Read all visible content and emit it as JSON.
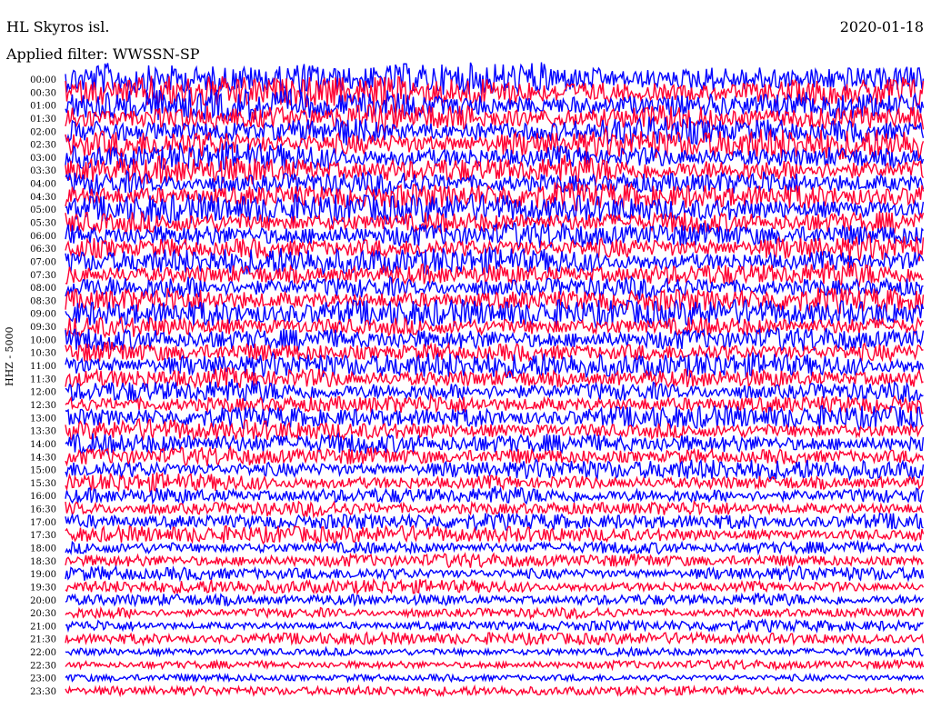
{
  "header": {
    "title": "HL Skyros isl.",
    "date": "2020-01-18",
    "filter": "Applied filter: WWSSN-SP"
  },
  "chart_data": {
    "type": "line",
    "title": "HL Skyros isl.",
    "ylabel": "HHZ - 5000",
    "categories": [
      "00:00",
      "00:30",
      "01:00",
      "01:30",
      "02:00",
      "02:30",
      "03:00",
      "03:30",
      "04:00",
      "04:30",
      "05:00",
      "05:30",
      "06:00",
      "06:30",
      "07:00",
      "07:30",
      "08:00",
      "08:30",
      "09:00",
      "09:30",
      "10:00",
      "10:30",
      "11:00",
      "11:30",
      "12:00",
      "12:30",
      "13:00",
      "13:30",
      "14:00",
      "14:30",
      "15:00",
      "15:30",
      "16:00",
      "16:30",
      "17:00",
      "17:30",
      "18:00",
      "18:30",
      "19:00",
      "19:30",
      "20:00",
      "20:30",
      "21:00",
      "21:30",
      "22:00",
      "22:30",
      "23:00",
      "23:30"
    ],
    "amplitude": [
      1.0,
      0.98,
      0.97,
      0.96,
      0.95,
      0.94,
      0.93,
      0.92,
      0.91,
      0.9,
      0.89,
      0.88,
      0.87,
      0.86,
      0.85,
      0.84,
      0.83,
      0.82,
      0.81,
      0.8,
      0.79,
      0.78,
      0.77,
      0.76,
      0.74,
      0.72,
      0.7,
      0.68,
      0.66,
      0.64,
      0.62,
      0.6,
      0.58,
      0.56,
      0.54,
      0.52,
      0.5,
      0.48,
      0.46,
      0.44,
      0.42,
      0.4,
      0.38,
      0.36,
      0.34,
      0.32,
      0.3,
      0.28
    ],
    "colors": [
      "#0000ff",
      "#ff0033"
    ]
  }
}
